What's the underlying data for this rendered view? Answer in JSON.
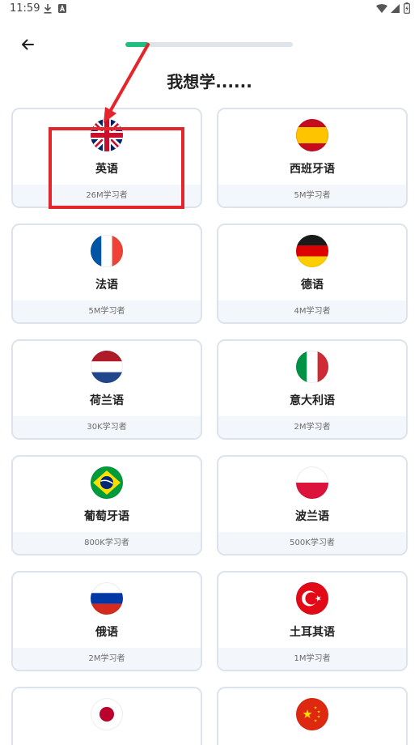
{
  "status_bar": {
    "time": "11:59",
    "icons": [
      "download-icon",
      "app-notification-icon",
      "wifi-icon",
      "cell-signal-icon",
      "battery-icon"
    ]
  },
  "header": {
    "back_icon": "back-arrow-icon",
    "progress": 0.14
  },
  "title": "我想学......",
  "languages": [
    {
      "name": "英语",
      "learners": "26M学习者",
      "flag_icon": "uk-flag-icon"
    },
    {
      "name": "西班牙语",
      "learners": "5M学习者",
      "flag_icon": "spain-flag-icon"
    },
    {
      "name": "法语",
      "learners": "5M学习者",
      "flag_icon": "france-flag-icon"
    },
    {
      "name": "德语",
      "learners": "4M学习者",
      "flag_icon": "germany-flag-icon"
    },
    {
      "name": "荷兰语",
      "learners": "30K学习者",
      "flag_icon": "netherlands-flag-icon"
    },
    {
      "name": "意大利语",
      "learners": "2M学习者",
      "flag_icon": "italy-flag-icon"
    },
    {
      "name": "葡萄牙语",
      "learners": "800K学习者",
      "flag_icon": "brazil-flag-icon"
    },
    {
      "name": "波兰语",
      "learners": "500K学习者",
      "flag_icon": "poland-flag-icon"
    },
    {
      "name": "俄语",
      "learners": "2M学习者",
      "flag_icon": "russia-flag-icon"
    },
    {
      "name": "土耳其语",
      "learners": "1M学习者",
      "flag_icon": "turkey-flag-icon"
    },
    {
      "flag_icon": "japan-flag-icon"
    },
    {
      "flag_icon": "china-flag-icon"
    }
  ],
  "colors": {
    "progress_fill": "#1fbe7e",
    "progress_track": "#dfe4ea",
    "card_border": "#dde3ec",
    "card_footer": "#f3f6fb",
    "annotation": "#e5252c"
  }
}
